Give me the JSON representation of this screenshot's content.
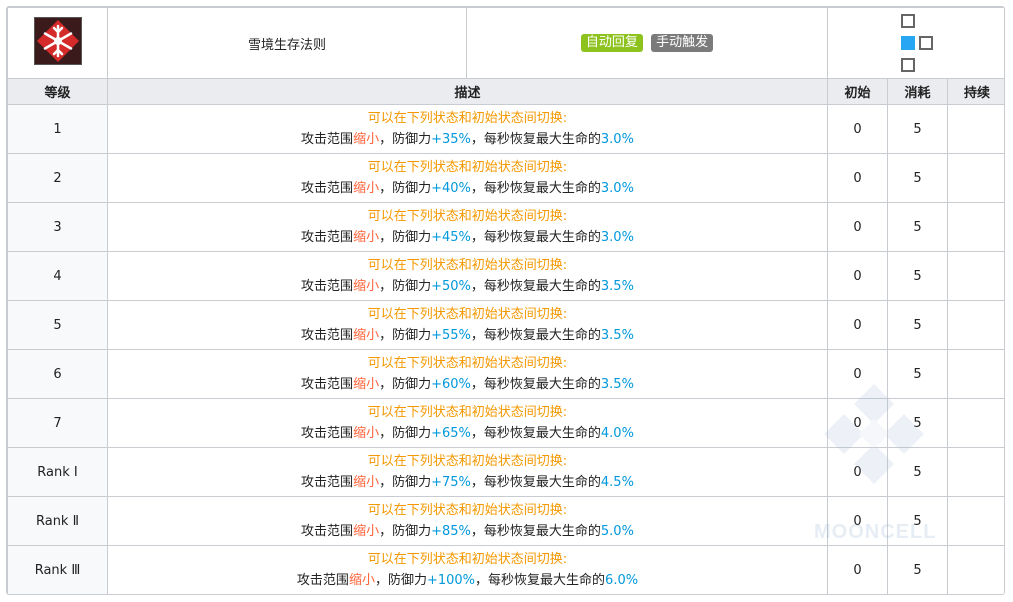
{
  "skill": {
    "name": "雪境生存法则",
    "icon": "snowflake-skill-icon",
    "tags": {
      "auto": "自动回复",
      "manual": "手动触发"
    },
    "range_grid": [
      [
        "tile",
        "none"
      ],
      [
        "self",
        "tile"
      ],
      [
        "tile",
        "none"
      ]
    ]
  },
  "columns": {
    "level": "等级",
    "description": "描述",
    "initial": "初始",
    "cost": "消耗",
    "duration": "持续"
  },
  "description_common": {
    "line1": "可以在下列状态和初始状态间切换:",
    "part_a": "攻击范围",
    "part_b": "缩小",
    "part_c": "，防御力",
    "part_d": "，每秒恢复最大生命的"
  },
  "rows": [
    {
      "level": "1",
      "defense": "+35%",
      "heal": "3.0%",
      "initial": "0",
      "cost": "5",
      "duration": ""
    },
    {
      "level": "2",
      "defense": "+40%",
      "heal": "3.0%",
      "initial": "0",
      "cost": "5",
      "duration": ""
    },
    {
      "level": "3",
      "defense": "+45%",
      "heal": "3.0%",
      "initial": "0",
      "cost": "5",
      "duration": ""
    },
    {
      "level": "4",
      "defense": "+50%",
      "heal": "3.5%",
      "initial": "0",
      "cost": "5",
      "duration": ""
    },
    {
      "level": "5",
      "defense": "+55%",
      "heal": "3.5%",
      "initial": "0",
      "cost": "5",
      "duration": ""
    },
    {
      "level": "6",
      "defense": "+60%",
      "heal": "3.5%",
      "initial": "0",
      "cost": "5",
      "duration": ""
    },
    {
      "level": "7",
      "defense": "+65%",
      "heal": "4.0%",
      "initial": "0",
      "cost": "5",
      "duration": ""
    },
    {
      "level": "Rank Ⅰ",
      "defense": "+75%",
      "heal": "4.5%",
      "initial": "0",
      "cost": "5",
      "duration": ""
    },
    {
      "level": "Rank Ⅱ",
      "defense": "+85%",
      "heal": "5.0%",
      "initial": "0",
      "cost": "5",
      "duration": ""
    },
    {
      "level": "Rank Ⅲ",
      "defense": "+100%",
      "heal": "6.0%",
      "initial": "0",
      "cost": "5",
      "duration": ""
    }
  ],
  "watermark": "MOONCELL",
  "colors": {
    "highlight_orange": "#f49800",
    "highlight_red": "#ff6237",
    "highlight_blue": "#0098dc",
    "tag_auto": "#8dc21f",
    "tag_manual": "#7b7b7b",
    "range_self": "#27a6f3"
  }
}
